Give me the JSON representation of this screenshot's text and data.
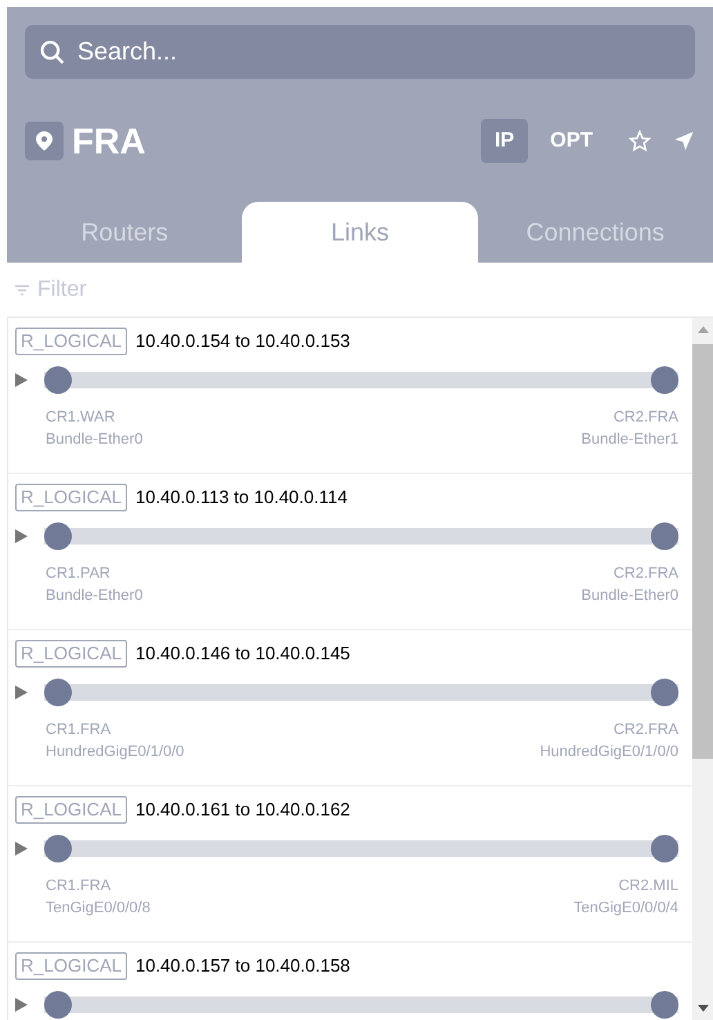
{
  "search": {
    "placeholder": "Search..."
  },
  "location": {
    "name": "FRA"
  },
  "view_toggles": [
    {
      "label": "IP",
      "selected": true
    },
    {
      "label": "OPT",
      "selected": false
    }
  ],
  "favorite": {
    "checked": false
  },
  "tabs": [
    {
      "label": "Routers",
      "selected": false
    },
    {
      "label": "Links",
      "selected": true
    },
    {
      "label": "Connections",
      "selected": false
    }
  ],
  "filter": {
    "placeholder": "Filter"
  },
  "links": [
    {
      "type": "R_LOGICAL",
      "title": "10.40.0.154 to 10.40.0.153",
      "expanded": false,
      "a_router": "CR1.WAR",
      "a_interface": "Bundle-Ether0",
      "b_router": "CR2.FRA",
      "b_interface": "Bundle-Ether1"
    },
    {
      "type": "R_LOGICAL",
      "title": "10.40.0.113 to 10.40.0.114",
      "expanded": false,
      "a_router": "CR1.PAR",
      "a_interface": "Bundle-Ether0",
      "b_router": "CR2.FRA",
      "b_interface": "Bundle-Ether0"
    },
    {
      "type": "R_LOGICAL",
      "title": "10.40.0.146 to 10.40.0.145",
      "expanded": false,
      "a_router": "CR1.FRA",
      "a_interface": "HundredGigE0/1/0/0",
      "b_router": "CR2.FRA",
      "b_interface": "HundredGigE0/1/0/0"
    },
    {
      "type": "R_LOGICAL",
      "title": "10.40.0.161 to 10.40.0.162",
      "expanded": false,
      "a_router": "CR1.FRA",
      "a_interface": "TenGigE0/0/0/8",
      "b_router": "CR2.MIL",
      "b_interface": "TenGigE0/0/0/4"
    },
    {
      "type": "R_LOGICAL",
      "title": "10.40.0.157 to 10.40.0.158",
      "expanded": false
    }
  ]
}
